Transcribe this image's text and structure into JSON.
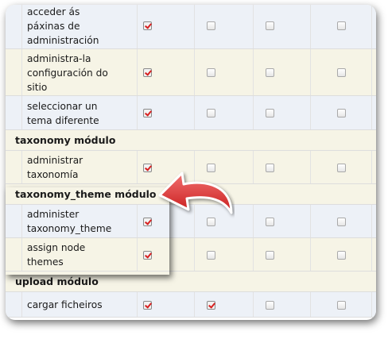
{
  "rows": [
    {
      "type": "perm",
      "label": [
        "acceder ás",
        "páxinas de",
        "administración"
      ],
      "checks": [
        true,
        false,
        false,
        false
      ]
    },
    {
      "type": "perm",
      "label": [
        "administra-la",
        "configuración do",
        "sitio"
      ],
      "checks": [
        true,
        false,
        false,
        false
      ]
    },
    {
      "type": "perm",
      "label": [
        "seleccionar un",
        "tema diferente"
      ],
      "checks": [
        true,
        false,
        false,
        false
      ]
    },
    {
      "type": "module",
      "label": "taxonomy módulo"
    },
    {
      "type": "perm",
      "label": [
        "administrar",
        "taxonomía"
      ],
      "checks": [
        true,
        false,
        false,
        false
      ]
    },
    {
      "type": "module",
      "label": "taxonomy_theme módulo"
    },
    {
      "type": "perm",
      "label": [
        "administer",
        "taxonomy_theme"
      ],
      "checks": [
        true,
        false,
        false,
        false
      ]
    },
    {
      "type": "perm",
      "label": [
        "assign node",
        "themes"
      ],
      "checks": [
        true,
        false,
        false,
        false
      ]
    },
    {
      "type": "module",
      "label": "upload módulo"
    },
    {
      "type": "perm",
      "label": [
        "cargar ficheiros"
      ],
      "checks": [
        true,
        true,
        false,
        false
      ]
    }
  ],
  "colors": {
    "check_mark": "#d62020",
    "arrow": "#e23b3b"
  },
  "icons": {
    "annotation_arrow": "curved-arrow-icon"
  }
}
